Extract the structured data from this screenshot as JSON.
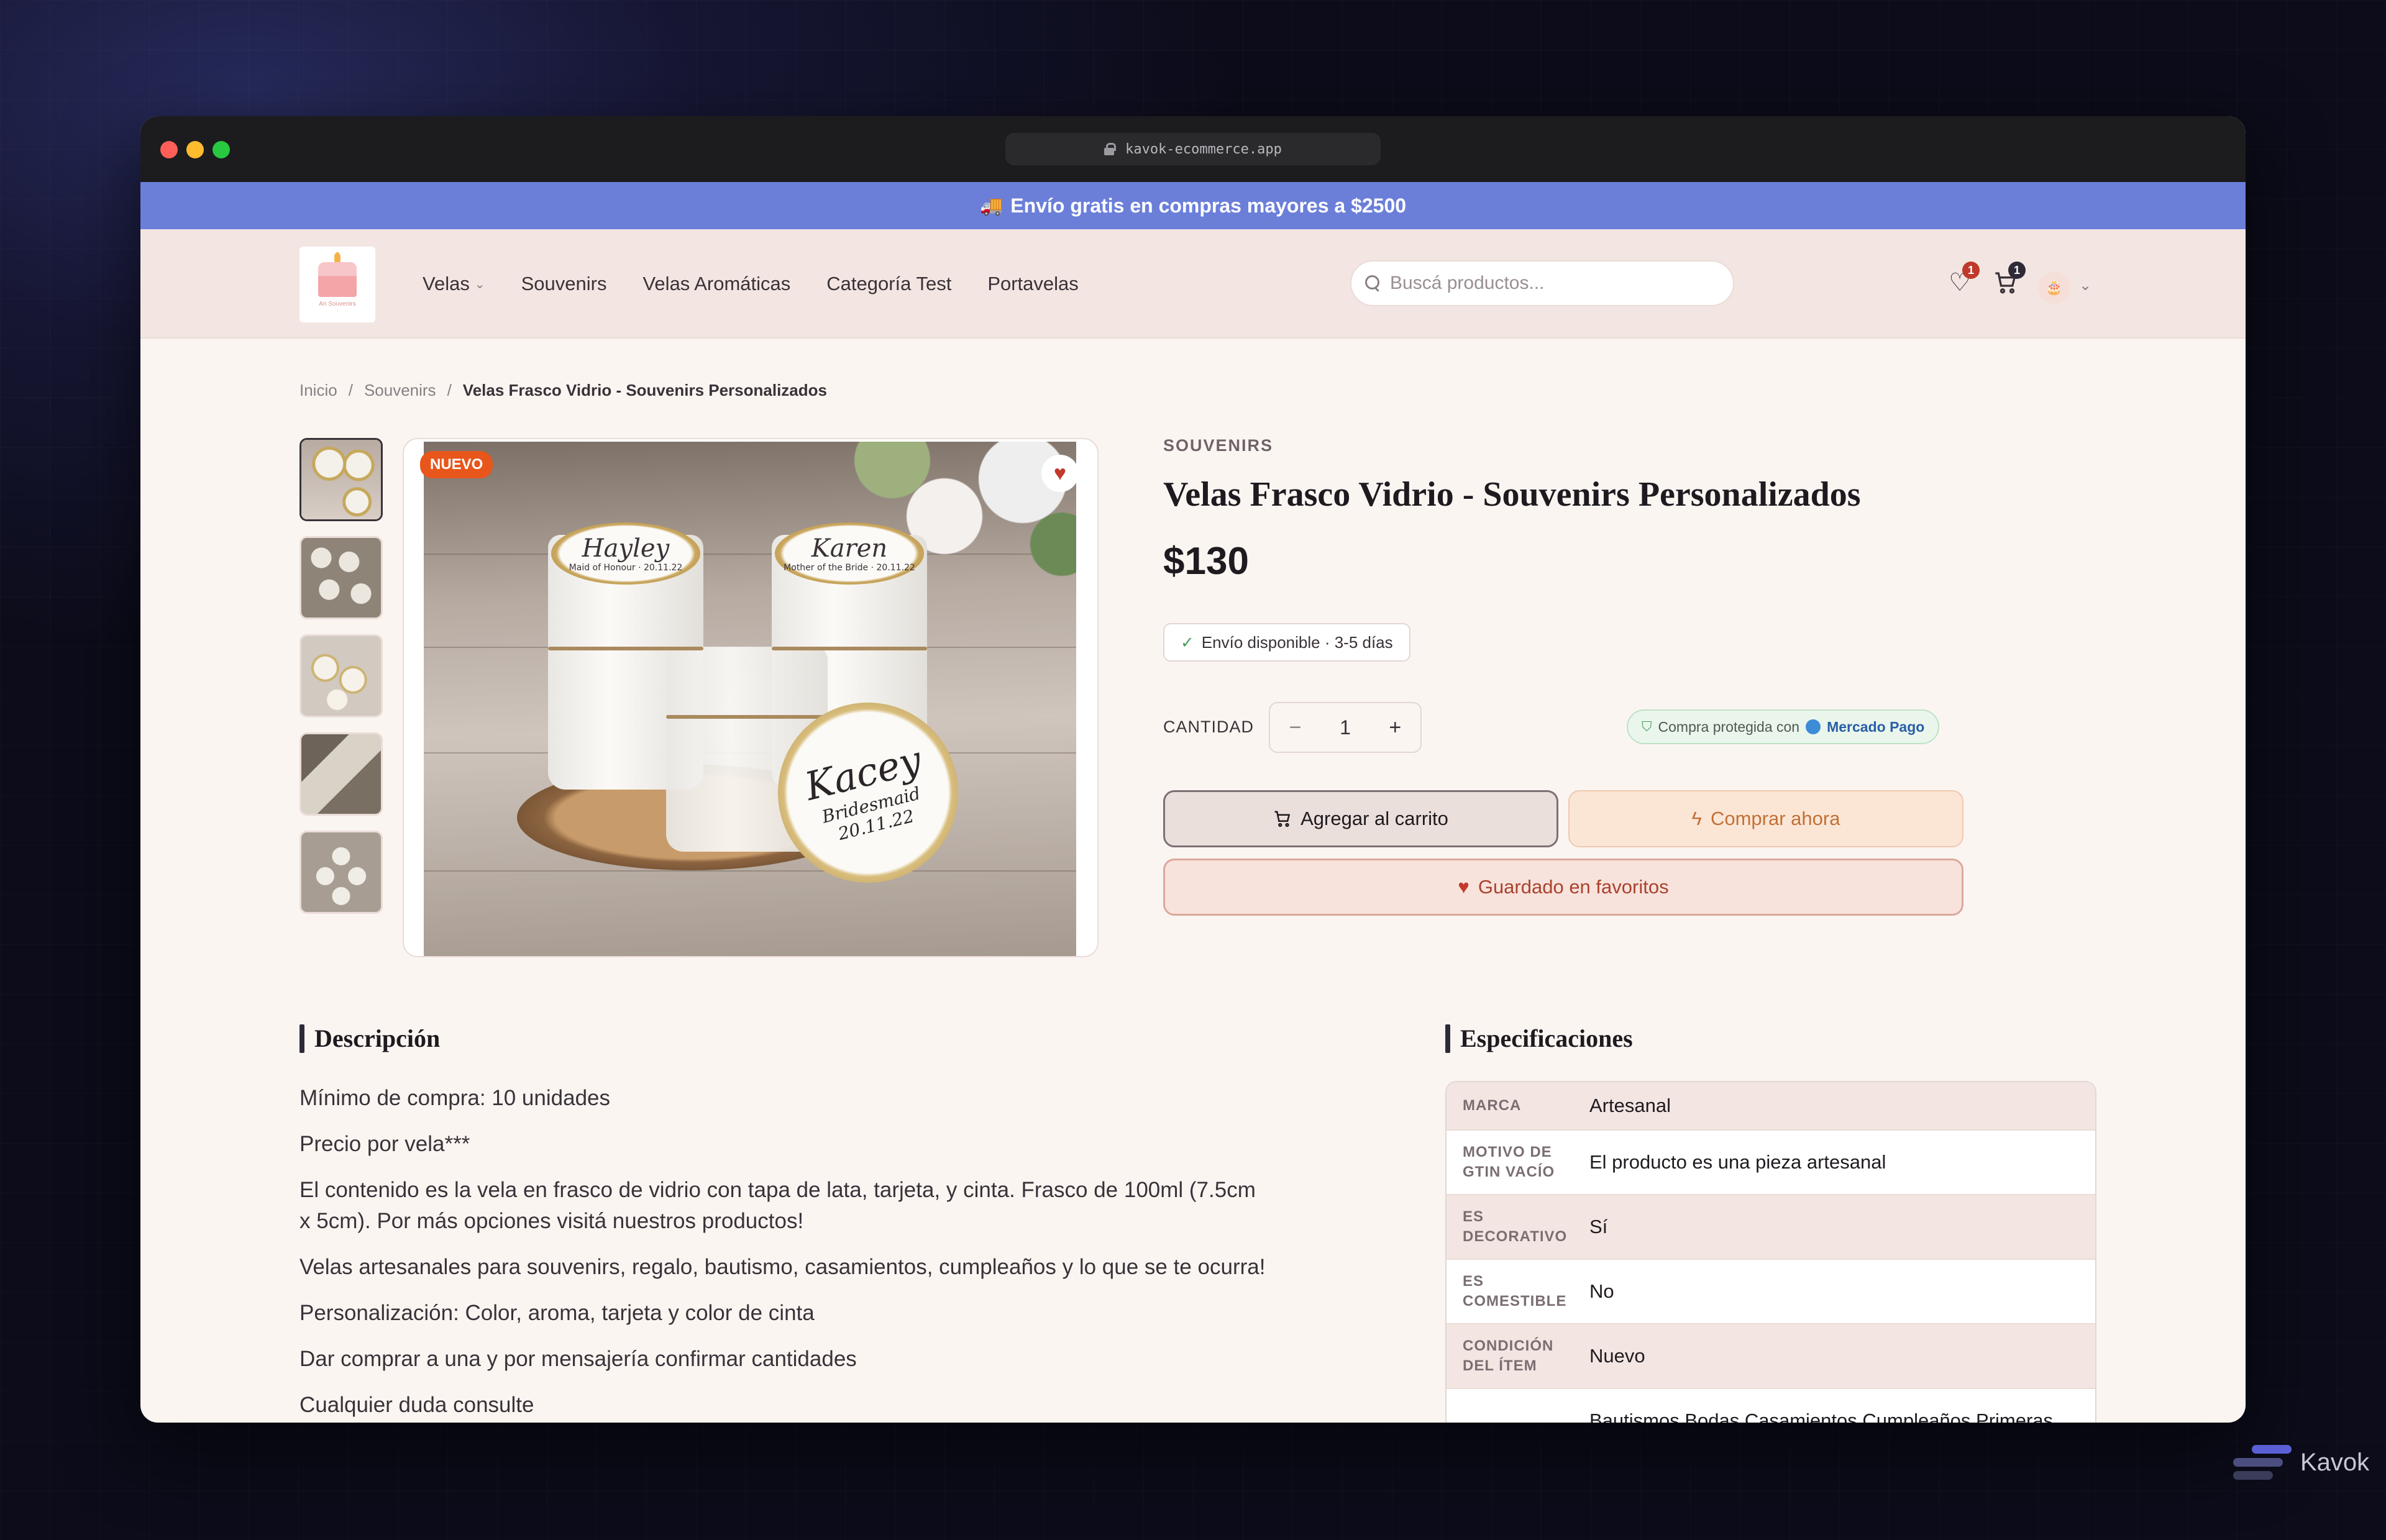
{
  "browser": {
    "url": "kavok-ecommerce.app"
  },
  "promo": {
    "text": "Envío gratis en compras mayores a $2500",
    "icon": "truck-icon"
  },
  "nav": {
    "logo_text": "Ari Souvenirs",
    "links": [
      {
        "label": "Velas",
        "has_dropdown": true
      },
      {
        "label": "Souvenirs"
      },
      {
        "label": "Velas Aromáticas"
      },
      {
        "label": "Categoría Test"
      },
      {
        "label": "Portavelas"
      }
    ],
    "search_placeholder": "Buscá productos...",
    "wishlist_count": "1",
    "cart_count": "1"
  },
  "breadcrumb": {
    "home": "Inicio",
    "sep": "/",
    "category": "Souvenirs",
    "current": "Velas Frasco Vidrio - Souvenirs Personalizados"
  },
  "gallery": {
    "badge": "NUEVO",
    "lid_names": [
      {
        "name": "Hayley",
        "sub": "Maid of Honour · 20.11.22"
      },
      {
        "name": "Karen",
        "sub": "Mother of the Bride · 20.11.22"
      }
    ],
    "round_lid": {
      "name": "Kacey",
      "role": "Bridesmaid",
      "date": "20.11.22"
    }
  },
  "product": {
    "category": "SOUVENIRS",
    "title": "Velas Frasco Vidrio - Souvenirs Personalizados",
    "price": "$130",
    "shipping": "Envío disponible · 3-5 días",
    "quantity_label": "CANTIDAD",
    "quantity": "1",
    "protected_text": "Compra protegida con",
    "payment_brand": "Mercado Pago",
    "add_to_cart": "Agregar al carrito",
    "buy_now": "Comprar ahora",
    "saved_favorites": "Guardado en favoritos"
  },
  "description": {
    "title": "Descripción",
    "paragraphs": [
      "Mínimo de compra: 10 unidades",
      "Precio por vela***",
      "El contenido es la vela en frasco de vidrio con tapa de lata, tarjeta, y cinta. Frasco de 100ml (7.5cm x 5cm). Por más opciones visitá nuestros productos!",
      "Velas artesanales para souvenirs, regalo, bautismo, casamientos, cumpleaños y lo que se te ocurra!",
      "Personalización: Color, aroma, tarjeta y color de cinta",
      "Dar comprar a una y por mensajería confirmar cantidades",
      "Cualquier duda consulte"
    ]
  },
  "specs": {
    "title": "Especificaciones",
    "rows": [
      {
        "key": "MARCA",
        "value": "Artesanal"
      },
      {
        "key": "MOTIVO DE GTIN VACÍO",
        "value": "El producto es una pieza artesanal"
      },
      {
        "key": "ES DECORATIVO",
        "value": "Sí"
      },
      {
        "key": "ES COMESTIBLE",
        "value": "No"
      },
      {
        "key": "CONDICIÓN DEL ÍTEM",
        "value": "Nuevo"
      },
      {
        "key": "",
        "value": "Bautismos,Bodas,Casamientos,Cumpleaños,Primeras"
      }
    ]
  },
  "watermark": {
    "text": "Kavok"
  }
}
